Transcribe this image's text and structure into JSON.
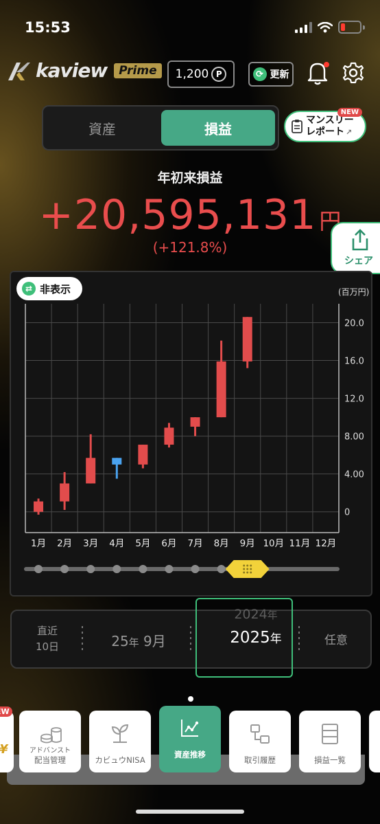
{
  "status": {
    "time": "15:53"
  },
  "header": {
    "logo_text": "kaview",
    "logo_badge": "Prime",
    "points": "1,200",
    "point_symbol": "P",
    "refresh_label": "更新"
  },
  "tabs_top": {
    "asset": "資産",
    "profit": "損益",
    "monthly_line1": "マンスリー",
    "monthly_line2": "レポート",
    "monthly_badge": "NEW"
  },
  "summary": {
    "label": "年初来損益",
    "value": "+20,595,131",
    "unit": "円",
    "percent": "(+121.8%)"
  },
  "share_label": "シェア",
  "hide_label": "非表示",
  "chart_data": {
    "type": "candlestick",
    "y_unit": "(百万円)",
    "categories": [
      "1月",
      "2月",
      "3月",
      "4月",
      "5月",
      "6月",
      "7月",
      "8月",
      "9月",
      "10月",
      "11月",
      "12月"
    ],
    "y_ticks": [
      "0",
      "4.00",
      "8.00",
      "12.0",
      "16.0",
      "20.0"
    ],
    "ylim": [
      -2.2,
      22
    ],
    "series": [
      {
        "open": 0.0,
        "close": 1.1,
        "high": 1.4,
        "low": -0.3
      },
      {
        "open": 1.1,
        "close": 3.0,
        "high": 4.2,
        "low": 0.2
      },
      {
        "open": 3.0,
        "close": 5.7,
        "high": 8.2,
        "low": 3.0
      },
      {
        "open": 5.7,
        "close": 5.0,
        "high": 5.7,
        "low": 3.5
      },
      {
        "open": 5.0,
        "close": 7.1,
        "high": 7.1,
        "low": 4.6
      },
      {
        "open": 7.1,
        "close": 8.9,
        "high": 9.4,
        "low": 6.8
      },
      {
        "open": 9.0,
        "close": 10.0,
        "high": 10.0,
        "low": 8.0
      },
      {
        "open": 10.0,
        "close": 15.9,
        "high": 18.1,
        "low": 10.0
      },
      {
        "open": 15.9,
        "close": 20.6,
        "high": 20.6,
        "low": 15.2
      }
    ],
    "colors": {
      "up": "#e24c4c",
      "down": "#4aa3f0"
    },
    "grid": true,
    "slider_selected_index": 8
  },
  "period": {
    "recent_line1": "直近",
    "recent_line2": "10日",
    "month_year": "25",
    "month_year_unit": "年",
    "month": "9",
    "month_unit": "月",
    "year_prev": "2024",
    "year_prev_unit": "年",
    "year_current": "2025",
    "year_current_unit": "年",
    "custom": "任意"
  },
  "bottom_tabs": [
    {
      "label_top": "アドバンスト",
      "label": "配当管理",
      "badge": "EW"
    },
    {
      "label": "カビュウNISA"
    },
    {
      "label": "資産推移"
    },
    {
      "label": "取引履歴"
    },
    {
      "label": "損益一覧"
    }
  ]
}
